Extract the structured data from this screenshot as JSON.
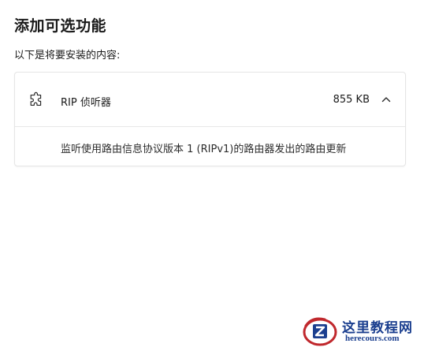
{
  "header": {
    "title": "添加可选功能",
    "subtitle": "以下是将要安装的内容:"
  },
  "feature": {
    "icon": "puzzle-piece-icon",
    "name": "RIP 侦听器",
    "size": "855 KB",
    "expanded": true,
    "description": "监听使用路由信息协议版本 1 (RIPv1)的路由器发出的路由更新"
  },
  "watermark": {
    "text_cn": "这里教程网",
    "text_en": "herecours.com",
    "colors": {
      "primary": "#1b3f8f",
      "accent": "#c0282d"
    }
  }
}
